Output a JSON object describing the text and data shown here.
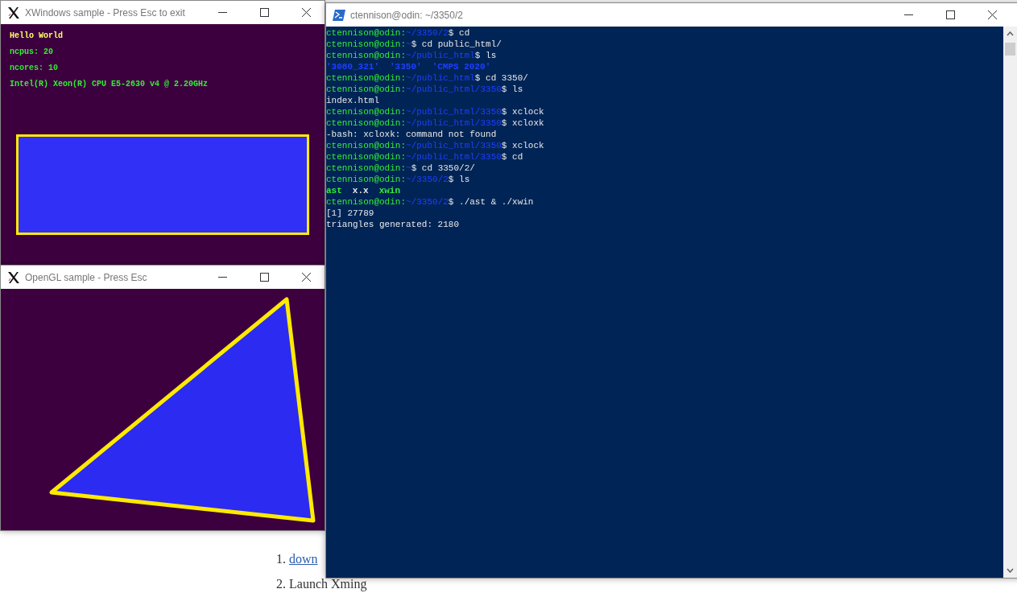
{
  "background_page": {
    "steps": [
      {
        "number": "1.",
        "text": "down",
        "link": true
      },
      {
        "number": "2.",
        "text": "Launch Xming",
        "link": false
      }
    ]
  },
  "xwindows_window": {
    "title": "XWindows sample -  Press Esc to exit",
    "lines": [
      {
        "text": "Hello World",
        "color": "#ffff66"
      },
      {
        "text": "ncpus: 20",
        "color": "#33ee33"
      },
      {
        "text": "ncores: 10",
        "color": "#2ee82e"
      },
      {
        "text": "Intel(R) Xeon(R) CPU E5-2630 v4 @ 2.20GHz",
        "color": "#33ee33"
      }
    ]
  },
  "opengl_window": {
    "title": "OpenGL sample  -  Press Esc"
  },
  "terminal_window": {
    "title": "ctennison@odin: ~/3350/2",
    "lines": [
      {
        "kind": "prompt",
        "user": "ctennison@odin:",
        "path": "~/3350/2",
        "command": "$ cd"
      },
      {
        "kind": "prompt",
        "user": "ctennison@odin:",
        "path": "~",
        "command": "$ cd public_html/"
      },
      {
        "kind": "prompt",
        "user": "ctennison@odin:",
        "path": "~/public_html",
        "command": "$ ls"
      },
      {
        "kind": "listing",
        "entries": [
          {
            "text": "'3080_321'",
            "color": "#1f3fff"
          },
          {
            "text": "'3350'",
            "color": "#1f3fff"
          },
          {
            "text": "'CMPS 2020'",
            "color": "#1f3fff"
          }
        ]
      },
      {
        "kind": "prompt",
        "user": "ctennison@odin:",
        "path": "~/public_html",
        "command": "$ cd 3350/"
      },
      {
        "kind": "prompt",
        "user": "ctennison@odin:",
        "path": "~/public_html/3350",
        "command": "$ ls"
      },
      {
        "kind": "output",
        "text": "index.html"
      },
      {
        "kind": "prompt",
        "user": "ctennison@odin:",
        "path": "~/public_html/3350",
        "command": "$ xclock"
      },
      {
        "kind": "prompt",
        "user": "ctennison@odin:",
        "path": "~/public_html/3350",
        "command": "$ xcloxk"
      },
      {
        "kind": "output",
        "text": "-bash: xcloxk: command not found"
      },
      {
        "kind": "prompt",
        "user": "ctennison@odin:",
        "path": "~/public_html/3350",
        "command": "$ xclock"
      },
      {
        "kind": "prompt",
        "user": "ctennison@odin:",
        "path": "~/public_html/3350",
        "command": "$ cd"
      },
      {
        "kind": "prompt",
        "user": "ctennison@odin:",
        "path": "~",
        "command": "$ cd 3350/2/"
      },
      {
        "kind": "prompt",
        "user": "ctennison@odin:",
        "path": "~/3350/2",
        "command": "$ ls"
      },
      {
        "kind": "listing",
        "entries": [
          {
            "text": "ast",
            "color": "#33ee33"
          },
          {
            "text": "x.x",
            "color": "#e8e8e8"
          },
          {
            "text": "xwin",
            "color": "#33ee33"
          }
        ]
      },
      {
        "kind": "prompt",
        "user": "ctennison@odin:",
        "path": "~/3350/2",
        "command": "$ ./ast & ./xwin"
      },
      {
        "kind": "output",
        "text": "[1] 27789"
      },
      {
        "kind": "output",
        "text": "triangles generated: 2180"
      }
    ]
  }
}
